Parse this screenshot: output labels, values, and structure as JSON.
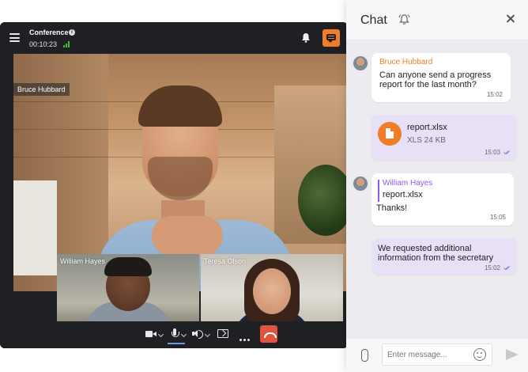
{
  "call": {
    "title": "Conference",
    "timer": "00:10:23",
    "participants": [
      {
        "name": "Bruce Hubbard"
      },
      {
        "name": "William Hayes"
      },
      {
        "name": "Teresa Olson"
      }
    ]
  },
  "chat": {
    "title": "Chat",
    "messages": [
      {
        "sender": "Bruce Hubbard",
        "text_line1": "Can anyone send a progress",
        "text_line2": "report for the last month?",
        "time": "15:02"
      },
      {
        "file_name": "report.xlsx",
        "file_meta": "XLS 24 KB",
        "time": "15:03"
      },
      {
        "quote_sender": "William Hayes",
        "quote_text": "report.xlsx",
        "text": "Thanks!",
        "time": "15:05"
      },
      {
        "text_line1": "We requested additional",
        "text_line2": "information from the secretary",
        "time": "15:02"
      }
    ],
    "input_placeholder": "Enter message..."
  },
  "colors": {
    "accent": "#f07e26",
    "hangup": "#e0533f",
    "own_message": "#e7e0f7",
    "quote": "#8b5cf6"
  }
}
